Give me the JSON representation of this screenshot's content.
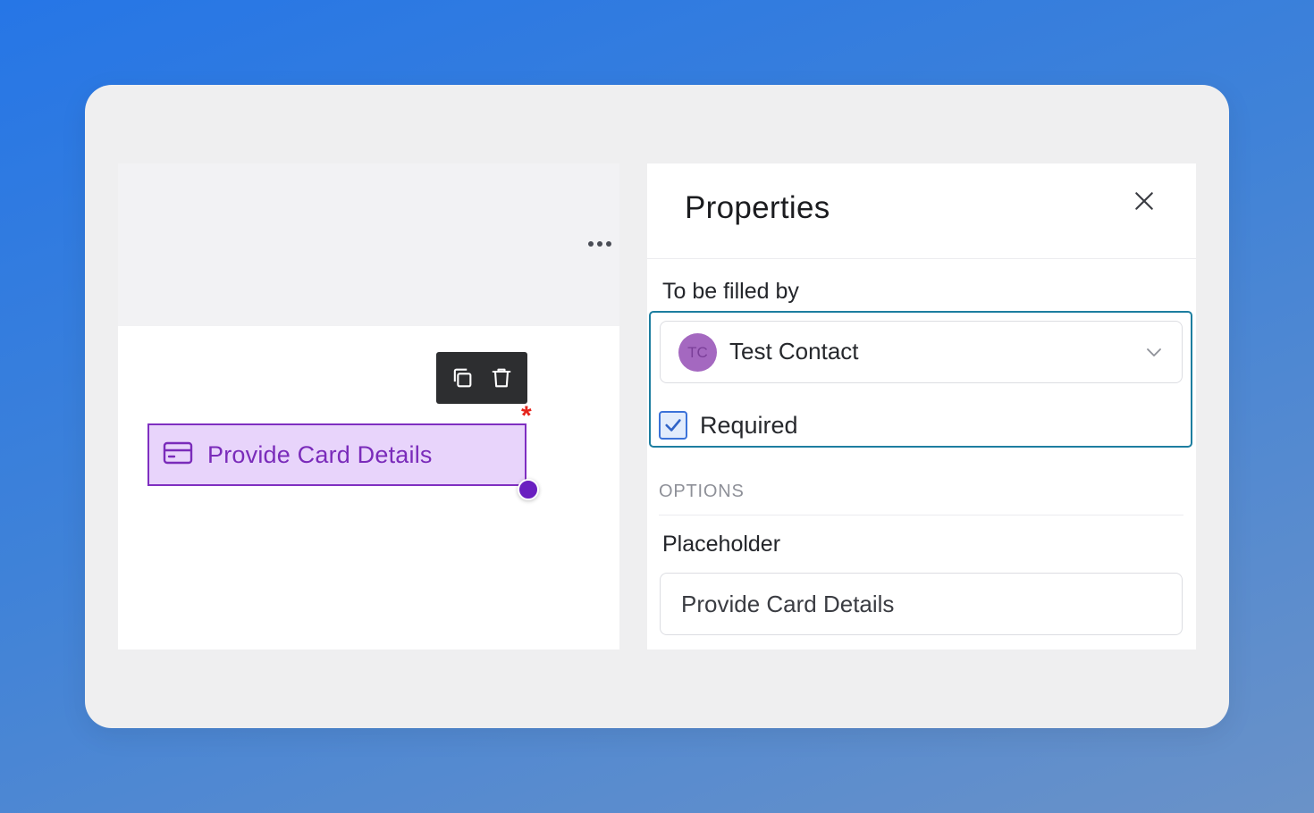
{
  "canvas": {
    "field_label": "Provide Card Details",
    "field_icon": "credit-card-icon",
    "required_marker": "*",
    "toolbar": {
      "duplicate_icon": "copy-icon",
      "delete_icon": "trash-icon"
    },
    "more_icon": "more-horizontal-icon"
  },
  "properties": {
    "title": "Properties",
    "close_icon": "close-icon",
    "filled_by_label": "To be filled by",
    "filled_by": {
      "avatar_initials": "TC",
      "value": "Test Contact"
    },
    "required_label": "Required",
    "required_checked": true,
    "options_heading": "OPTIONS",
    "placeholder_label": "Placeholder",
    "placeholder_value": "Provide Card Details"
  },
  "colors": {
    "accent_purple": "#7f2fc1",
    "field_fill": "#e8d4fb",
    "focus_teal": "#1d7ea0",
    "checkbox_blue": "#3b72d9",
    "required_red": "#e5231b"
  }
}
